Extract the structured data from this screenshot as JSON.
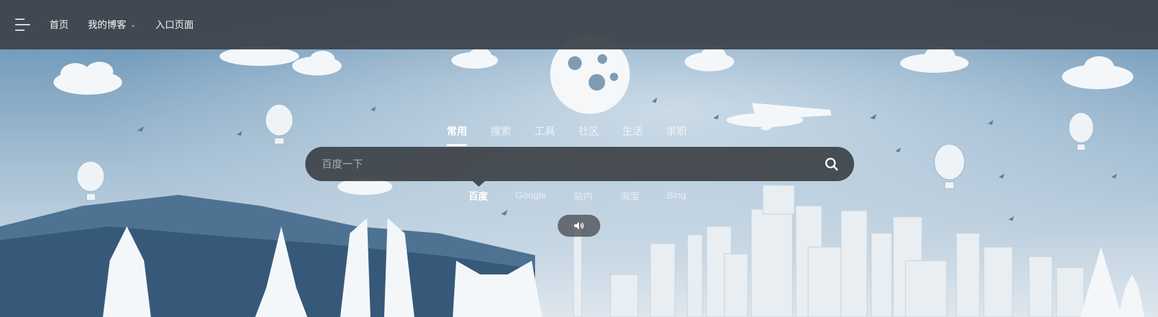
{
  "nav": {
    "items": [
      {
        "label": "首页"
      },
      {
        "label": "我的博客"
      },
      {
        "label": "入口页面"
      }
    ]
  },
  "search": {
    "tabs": [
      {
        "label": "常用"
      },
      {
        "label": "搜索"
      },
      {
        "label": "工具"
      },
      {
        "label": "社区"
      },
      {
        "label": "生活"
      },
      {
        "label": "求职"
      }
    ],
    "placeholder": "百度一下",
    "engines": [
      {
        "label": "百度"
      },
      {
        "label": "Google"
      },
      {
        "label": "站内"
      },
      {
        "label": "淘宝"
      },
      {
        "label": "Bing"
      }
    ]
  },
  "icons": {
    "menu": "menu-icon",
    "search": "search-icon",
    "sound": "sound-icon",
    "caret": "chevron-down-icon"
  },
  "colors": {
    "topbar": "#3e464e",
    "sky": "#8fb0c9",
    "search_bg": "#363a3f"
  }
}
